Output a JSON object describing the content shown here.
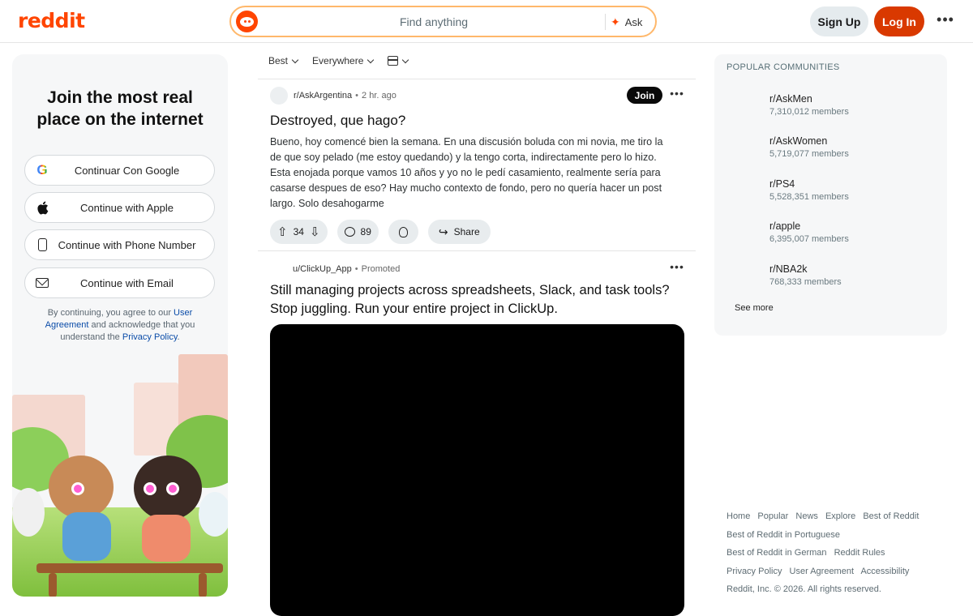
{
  "header": {
    "logo": "reddit",
    "search_placeholder": "Find anything",
    "ask_label": "Ask",
    "signup_label": "Sign Up",
    "login_label": "Log In",
    "more_label": "•••"
  },
  "login_card": {
    "title_line1": "Join the most real",
    "title_line2": "place on the internet",
    "buttons": [
      {
        "label": "Continuar Con Google",
        "icon": "google-icon"
      },
      {
        "label": "Continue with Apple",
        "icon": "apple-icon"
      },
      {
        "label": "Continue with Phone Number",
        "icon": "phone-icon"
      },
      {
        "label": "Continue with Email",
        "icon": "email-icon"
      }
    ],
    "legal_prefix": "By continuing, you agree to our ",
    "legal_link1": "User Agreement",
    "legal_mid": " and acknowledge that you understand the ",
    "legal_link2": "Privacy Policy",
    "legal_suffix": "."
  },
  "feed": {
    "sort": "Best",
    "location": "Everywhere",
    "post1": {
      "subreddit": "r/AskArgentina",
      "time": "2 hr. ago",
      "join_label": "Join",
      "title": "Destroyed, que hago?",
      "body": "Bueno, hoy comencé bien la semana. En una discusión boluda con mi novia, me tiro la de que soy pelado (me estoy quedando) y la tengo corta, indirectamente pero lo hizo. Esta enojada porque vamos 10 años y yo no le pedí casamiento, realmente sería para casarse despues de eso? Hay mucho contexto de fondo, pero no quería hacer un post largo. Solo desahogarme",
      "votes": "34",
      "comments": "89",
      "share_label": "Share"
    },
    "post2": {
      "user": "u/ClickUp_App",
      "promoted_label": "Promoted",
      "title": "Still managing projects across spreadsheets, Slack, and task tools? Stop juggling. Run your entire project in ClickUp."
    }
  },
  "sidebar": {
    "title": "POPULAR COMMUNITIES",
    "communities": [
      {
        "name": "r/AskMen",
        "members": "7,310,012 members"
      },
      {
        "name": "r/AskWomen",
        "members": "5,719,077 members"
      },
      {
        "name": "r/PS4",
        "members": "5,528,351 members"
      },
      {
        "name": "r/apple",
        "members": "6,395,007 members"
      },
      {
        "name": "r/NBA2k",
        "members": "768,333 members"
      }
    ],
    "see_more": "See more"
  },
  "footer": {
    "links_row1": [
      "Home",
      "Popular",
      "News",
      "Explore",
      "Best of Reddit"
    ],
    "row2": "Best of Reddit in Portuguese",
    "links_row3": [
      "Best of Reddit in German",
      "Reddit Rules"
    ],
    "links_row4": [
      "Privacy Policy",
      "User Agreement",
      "Accessibility"
    ],
    "copyright": "Reddit, Inc. © 2026. All rights reserved."
  }
}
